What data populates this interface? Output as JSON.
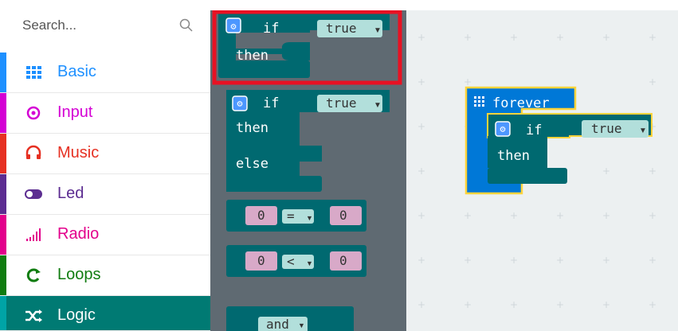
{
  "search": {
    "placeholder": "Search..."
  },
  "categories": [
    {
      "label": "Basic",
      "color": "#1e90ff",
      "icon": "grid-icon"
    },
    {
      "label": "Input",
      "color": "#d400d4",
      "icon": "target-icon"
    },
    {
      "label": "Music",
      "color": "#e63022",
      "icon": "headphones-icon"
    },
    {
      "label": "Led",
      "color": "#5c2d91",
      "icon": "toggle-icon"
    },
    {
      "label": "Radio",
      "color": "#e3008c",
      "icon": "signal-bars-icon"
    },
    {
      "label": "Loops",
      "color": "#107c10",
      "icon": "loop-icon"
    },
    {
      "label": "Logic",
      "color": "#00a4a6",
      "icon": "shuffle-icon"
    }
  ],
  "flyout": {
    "if_then": {
      "if": "if",
      "value": "true",
      "then": "then"
    },
    "if_then_else": {
      "if": "if",
      "value": "true",
      "then": "then",
      "else": "else"
    },
    "compare_eq": {
      "left": "0",
      "op": "=",
      "right": "0"
    },
    "compare_lt": {
      "left": "0",
      "op": "<",
      "right": "0"
    },
    "and_block": {
      "op": "and"
    }
  },
  "workspace": {
    "forever": {
      "label": "forever"
    },
    "inner_if": {
      "if": "if",
      "value": "true",
      "then": "then"
    }
  },
  "colors": {
    "logic": "#006970",
    "loops": "#0078d7",
    "highlight": "#ffd43b",
    "selection": "#e81123"
  }
}
